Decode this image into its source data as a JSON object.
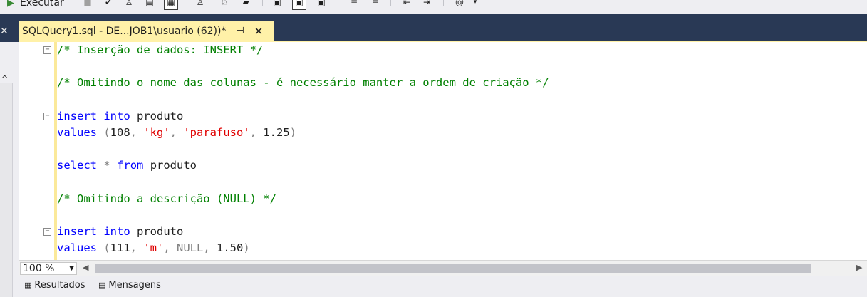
{
  "toolbar": {
    "execute_label": "Executar",
    "icons": [
      "play-icon",
      "stop-icon",
      "check-icon",
      "parse-icon",
      "plan-icon",
      "results-grid-icon",
      "results-text-icon",
      "include-stats-icon",
      "comment-icon",
      "uncomment-icon",
      "indent-icon",
      "outdent-icon",
      "specify-values-icon",
      "dropdown-icon"
    ]
  },
  "tab": {
    "title": "SQLQuery1.sql - DE...JOB1\\usuario (62))*",
    "pin_glyph": "⊣",
    "close_glyph": "✕"
  },
  "side_close_glyph": "✕",
  "editor": {
    "lines": [
      {
        "row": 0,
        "fold": true,
        "tokens": [
          {
            "t": "/* Inserção de dados: INSERT */",
            "c": "cm"
          }
        ]
      },
      {
        "row": 2,
        "fold": false,
        "tokens": [
          {
            "t": "/* Omitindo o nome das colunas - é necessário manter a ordem de criação */",
            "c": "cm"
          }
        ]
      },
      {
        "row": 4,
        "fold": true,
        "tokens": [
          {
            "t": "insert",
            "c": "kw"
          },
          {
            "t": " ",
            "c": "id"
          },
          {
            "t": "into",
            "c": "kw"
          },
          {
            "t": " produto",
            "c": "id"
          }
        ]
      },
      {
        "row": 5,
        "fold": false,
        "tokens": [
          {
            "t": "values",
            "c": "kw"
          },
          {
            "t": " (",
            "c": "op"
          },
          {
            "t": "108",
            "c": "id"
          },
          {
            "t": ", ",
            "c": "op"
          },
          {
            "t": "'kg'",
            "c": "str"
          },
          {
            "t": ", ",
            "c": "op"
          },
          {
            "t": "'parafuso'",
            "c": "str"
          },
          {
            "t": ", ",
            "c": "op"
          },
          {
            "t": "1.25",
            "c": "id"
          },
          {
            "t": ")",
            "c": "op"
          }
        ]
      },
      {
        "row": 7,
        "fold": false,
        "tokens": [
          {
            "t": "select",
            "c": "kw"
          },
          {
            "t": " ",
            "c": "id"
          },
          {
            "t": "*",
            "c": "op"
          },
          {
            "t": " ",
            "c": "id"
          },
          {
            "t": "from",
            "c": "kw"
          },
          {
            "t": " produto",
            "c": "id"
          }
        ]
      },
      {
        "row": 9,
        "fold": false,
        "tokens": [
          {
            "t": "/* Omitindo a descrição (NULL) */",
            "c": "cm"
          }
        ]
      },
      {
        "row": 11,
        "fold": true,
        "tokens": [
          {
            "t": "insert",
            "c": "kw"
          },
          {
            "t": " ",
            "c": "id"
          },
          {
            "t": "into",
            "c": "kw"
          },
          {
            "t": " produto",
            "c": "id"
          }
        ]
      },
      {
        "row": 12,
        "fold": false,
        "tokens": [
          {
            "t": "values",
            "c": "kw"
          },
          {
            "t": " (",
            "c": "op"
          },
          {
            "t": "111",
            "c": "id"
          },
          {
            "t": ", ",
            "c": "op"
          },
          {
            "t": "'m'",
            "c": "str"
          },
          {
            "t": ", ",
            "c": "op"
          },
          {
            "t": "NULL",
            "c": "nul"
          },
          {
            "t": ", ",
            "c": "op"
          },
          {
            "t": "1.50",
            "c": "id"
          },
          {
            "t": ")",
            "c": "op"
          }
        ]
      }
    ]
  },
  "status": {
    "zoom_value": "100 %"
  },
  "result_tabs": [
    {
      "label": "Resultados",
      "icon": "grid-icon"
    },
    {
      "label": "Mensagens",
      "icon": "messages-icon"
    }
  ]
}
